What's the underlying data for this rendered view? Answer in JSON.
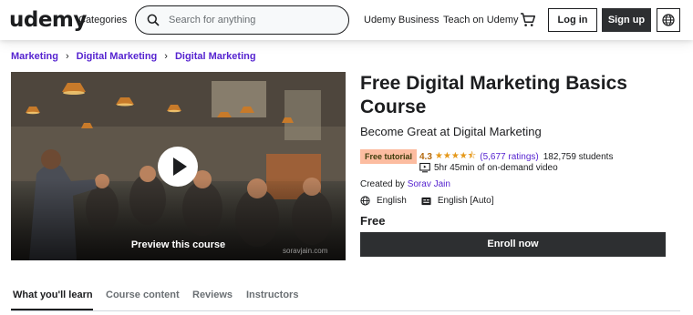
{
  "header": {
    "logo": "udemy",
    "categories": "Categories",
    "search_placeholder": "Search for anything",
    "business": "Udemy Business",
    "teach": "Teach on Udemy",
    "login": "Log in",
    "signup": "Sign up"
  },
  "breadcrumb": [
    "Marketing",
    "Digital Marketing",
    "Digital Marketing"
  ],
  "preview": {
    "label": "Preview this course",
    "watermark": "soravjain.com"
  },
  "course": {
    "title": "Free Digital Marketing Basics Course",
    "subtitle": "Become Great at Digital Marketing",
    "badge": "Free tutorial",
    "rating": "4.3",
    "stars": "★★★★⯪",
    "ratings_count": "(5,677 ratings)",
    "students": "182,759 students",
    "duration": "5hr 45min of on-demand video",
    "created_label": "Created by",
    "author": "Sorav Jain",
    "language": "English",
    "captions": "English [Auto]",
    "price": "Free",
    "enroll": "Enroll now"
  },
  "tabs": [
    "What you'll learn",
    "Course content",
    "Reviews",
    "Instructors"
  ],
  "colors": {
    "accent": "#5624d0",
    "dark": "#2d2f31",
    "badge": "#fcbca0",
    "star": "#e59819"
  }
}
